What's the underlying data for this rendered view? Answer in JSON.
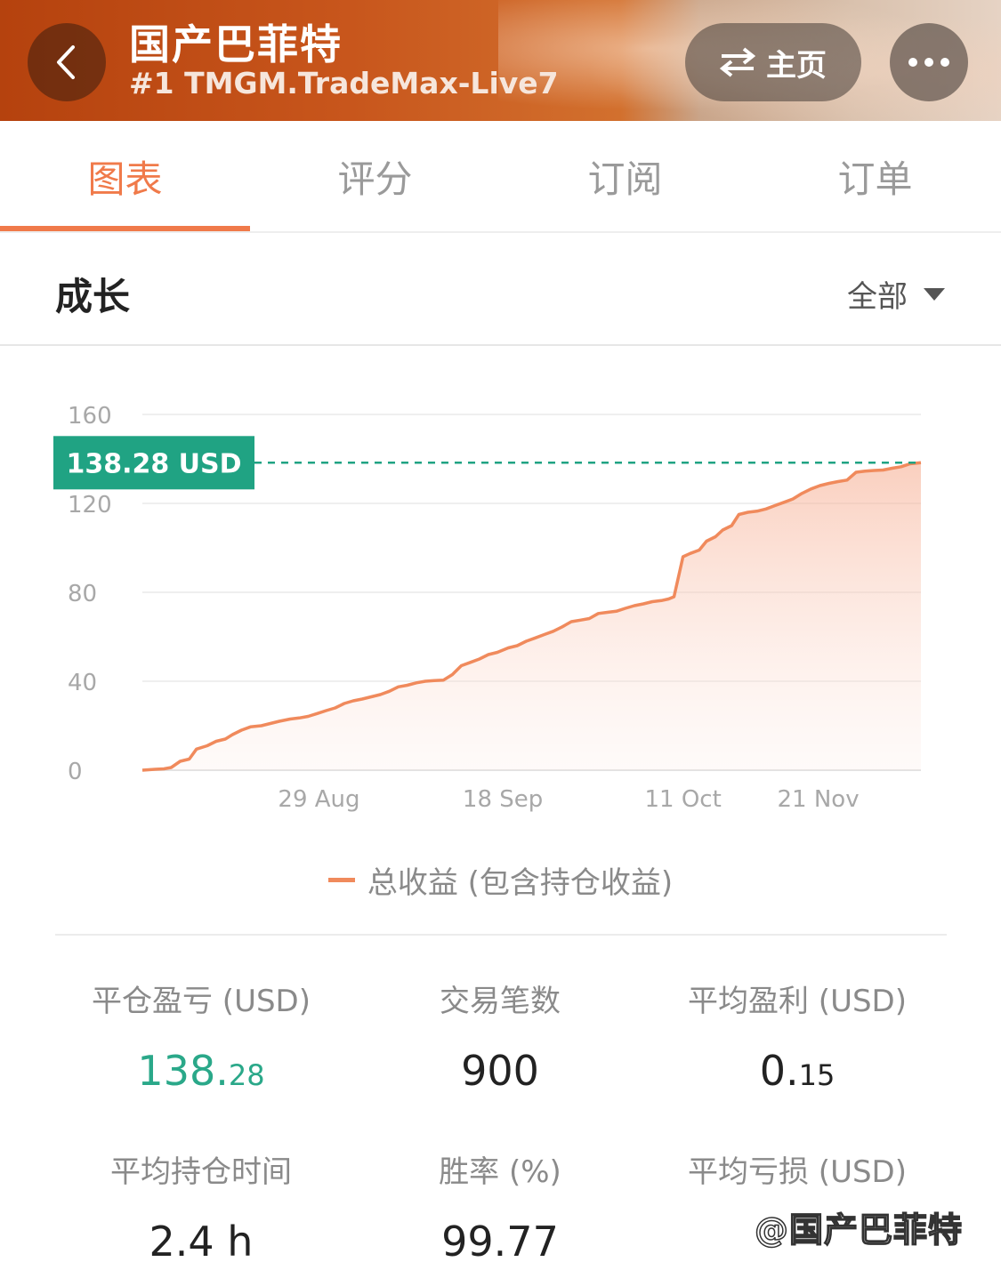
{
  "header": {
    "title": "国产巴菲特",
    "subtitle": "#1 TMGM.TradeMax-Live7",
    "home_label": "主页"
  },
  "tabs": [
    {
      "label": "图表",
      "active": true
    },
    {
      "label": "评分",
      "active": false
    },
    {
      "label": "订阅",
      "active": false
    },
    {
      "label": "订单",
      "active": false
    }
  ],
  "section": {
    "title": "成长",
    "range_label": "全部"
  },
  "chart_data": {
    "type": "area",
    "yticks": [
      "0",
      "40",
      "80",
      "120",
      "160"
    ],
    "ylim": [
      0,
      160
    ],
    "xticks": [
      {
        "label": "29 Aug",
        "x": 9.8
      },
      {
        "label": "18 Sep",
        "x": 20
      },
      {
        "label": "11 Oct",
        "x": 30
      },
      {
        "label": "21 Nov",
        "x": 37.5
      }
    ],
    "grid": true,
    "current_value_label": "138.28 USD",
    "current_value": 138.28,
    "series": [
      {
        "name": "总收益 (包含持仓收益)",
        "color": "#f08a5c",
        "points": [
          [
            0,
            0
          ],
          [
            0.7,
            0.4
          ],
          [
            1.2,
            0.6
          ],
          [
            1.6,
            1.2
          ],
          [
            2.1,
            4
          ],
          [
            2.6,
            5
          ],
          [
            3,
            9.5
          ],
          [
            3.6,
            11
          ],
          [
            4.1,
            13
          ],
          [
            4.6,
            14
          ],
          [
            5,
            16
          ],
          [
            5.5,
            18
          ],
          [
            6,
            19.5
          ],
          [
            6.6,
            20
          ],
          [
            7.1,
            21
          ],
          [
            7.6,
            22
          ],
          [
            8.2,
            23
          ],
          [
            8.7,
            23.5
          ],
          [
            9.2,
            24.2
          ],
          [
            9.7,
            25.5
          ],
          [
            10.2,
            26.8
          ],
          [
            10.7,
            28
          ],
          [
            11.2,
            30
          ],
          [
            11.7,
            31.2
          ],
          [
            12.2,
            32
          ],
          [
            12.7,
            33
          ],
          [
            13.2,
            34
          ],
          [
            13.7,
            35.5
          ],
          [
            14.2,
            37.5
          ],
          [
            14.7,
            38.2
          ],
          [
            15.2,
            39.3
          ],
          [
            15.7,
            40
          ],
          [
            16.2,
            40.3
          ],
          [
            16.7,
            40.5
          ],
          [
            17.2,
            43
          ],
          [
            17.7,
            47
          ],
          [
            18.2,
            48.5
          ],
          [
            18.7,
            50
          ],
          [
            19.2,
            52
          ],
          [
            19.7,
            53
          ],
          [
            20.3,
            55
          ],
          [
            20.8,
            56
          ],
          [
            21.3,
            58
          ],
          [
            21.8,
            59.5
          ],
          [
            22.3,
            61
          ],
          [
            22.8,
            62.5
          ],
          [
            23.3,
            64.5
          ],
          [
            23.8,
            66.8
          ],
          [
            24.3,
            67.5
          ],
          [
            24.8,
            68.2
          ],
          [
            25.3,
            70.5
          ],
          [
            25.8,
            71
          ],
          [
            26.3,
            71.5
          ],
          [
            26.8,
            72.8
          ],
          [
            27.3,
            74
          ],
          [
            27.8,
            74.8
          ],
          [
            28.3,
            75.8
          ],
          [
            28.8,
            76.3
          ],
          [
            29.2,
            77
          ],
          [
            29.5,
            78
          ],
          [
            30.0,
            96
          ],
          [
            30.4,
            97.5
          ],
          [
            30.9,
            99
          ],
          [
            31.3,
            103
          ],
          [
            31.8,
            105
          ],
          [
            32.2,
            108
          ],
          [
            32.7,
            110
          ],
          [
            33.1,
            115
          ],
          [
            33.6,
            116
          ],
          [
            34.1,
            116.5
          ],
          [
            34.6,
            117.5
          ],
          [
            35.1,
            119
          ],
          [
            35.6,
            120.5
          ],
          [
            36.1,
            122
          ],
          [
            36.6,
            124.5
          ],
          [
            37.1,
            126.5
          ],
          [
            37.6,
            128
          ],
          [
            38.1,
            129
          ],
          [
            38.6,
            129.8
          ],
          [
            39.1,
            130.5
          ],
          [
            39.6,
            134
          ],
          [
            40.1,
            134.5
          ],
          [
            40.6,
            134.8
          ],
          [
            41.1,
            135
          ],
          [
            41.6,
            135.8
          ],
          [
            42.1,
            136.5
          ],
          [
            42.6,
            137.8
          ],
          [
            43.2,
            138.28
          ]
        ]
      }
    ]
  },
  "stats": [
    {
      "label": "平仓盈亏 (USD)",
      "value_int": "138.",
      "value_dec": "28",
      "color": "teal"
    },
    {
      "label": "交易笔数",
      "value_int": "900",
      "value_dec": "",
      "color": "dark"
    },
    {
      "label": "平均盈利 (USD)",
      "value_int": "0.",
      "value_dec": "15",
      "color": "dark"
    },
    {
      "label": "平均持仓时间",
      "value_int": "2.4 h",
      "value_dec": "",
      "color": "dark"
    },
    {
      "label": "胜率 (%)",
      "value_int": "99.77",
      "value_dec": "",
      "color": "dark"
    },
    {
      "label": "平均亏损 (USD)",
      "value_int": "",
      "value_dec": "",
      "color": "dark"
    }
  ],
  "watermark": "@国产巴菲特",
  "colors": {
    "accent": "#f07a4a",
    "line": "#f08a5c",
    "teal": "#2aa889",
    "tag": "#20a383"
  }
}
